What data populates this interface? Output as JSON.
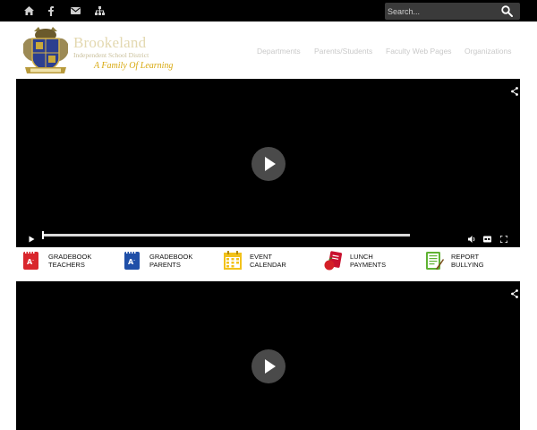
{
  "topbar": {
    "icons": [
      "home-icon",
      "facebook-icon",
      "envelope-icon",
      "sitemap-icon"
    ],
    "search_placeholder": "Search..."
  },
  "brand": {
    "name": "Brookeland",
    "subtitle": "Independent School District",
    "tagline": "A Family Of Learning"
  },
  "nav": {
    "items": [
      "Departments",
      "Parents/Students",
      "Faculty Web Pages",
      "Organizations"
    ]
  },
  "quicklinks": [
    {
      "line1": "GRADEBOOK",
      "line2": "TEACHERS",
      "icon": "gradebook-teachers-icon",
      "color": "#d9262c"
    },
    {
      "line1": "GRADEBOOK",
      "line2": "PARENTS",
      "icon": "gradebook-parents-icon",
      "color": "#1f4fa8"
    },
    {
      "line1": "EVENT",
      "line2": "CALENDAR",
      "icon": "calendar-icon",
      "color": "#f2c21a"
    },
    {
      "line1": "LUNCH",
      "line2": "PAYMENTS",
      "icon": "lunch-icon",
      "color": "#c8102e"
    },
    {
      "line1": "REPORT",
      "line2": "BULLYING",
      "icon": "report-icon",
      "color": "#5fb233"
    }
  ],
  "video": {
    "progress": 0
  }
}
